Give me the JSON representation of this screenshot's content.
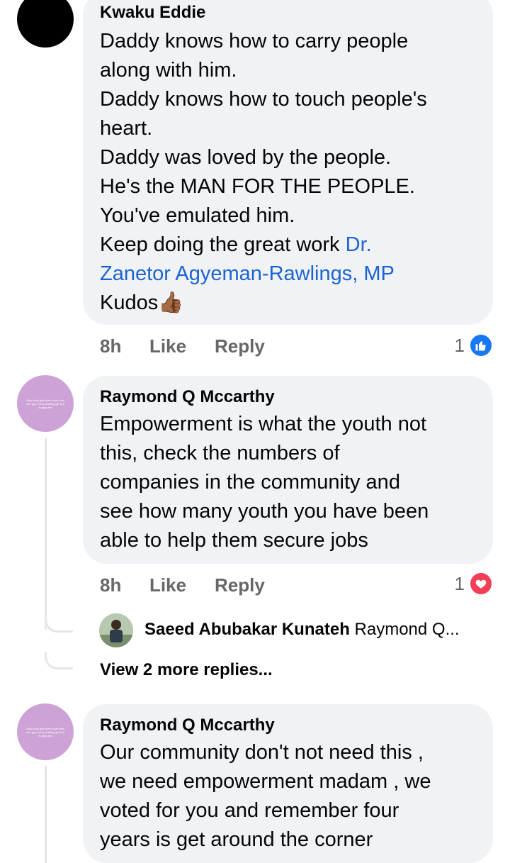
{
  "comments": [
    {
      "author": "Kwaku Eddie",
      "lines": [
        "Daddy knows how to carry people",
        "along with him.",
        "Daddy knows how to touch people's",
        "heart.",
        "Daddy was loved by the people.",
        "He's the MAN FOR THE PEOPLE.",
        "You've emulated him.",
        "Keep doing the great work "
      ],
      "mention_part1": "Dr.",
      "mention_part2": "Zanetor Agyeman-Rawlings, MP",
      "last_line": "Kudos",
      "emoji": "👍🏾",
      "time": "8h",
      "like": "Like",
      "reply": "Reply",
      "reaction_count": "1",
      "reaction_type": "like-icon",
      "reaction_color": "#1877f2"
    },
    {
      "author": "Raymond Q Mccarthy",
      "avatar_text": "Only fools give their more than one guy every chatting girl is a hungry lion",
      "lines": [
        "Empowerment is what the youth not",
        "this, check the numbers of",
        "companies in the community and",
        "see how many youth you have been",
        "able to help them secure jobs"
      ],
      "time": "8h",
      "like": "Like",
      "reply": "Reply",
      "reaction_count": "1",
      "reaction_type": "heart-icon",
      "reaction_color": "#f33e58",
      "reply_preview": {
        "author": "Saeed Abubakar Kunateh",
        "snippet": "Raymond Q..."
      },
      "view_more": "View 2 more replies..."
    },
    {
      "author": "Raymond Q Mccarthy",
      "avatar_text": "Only fools give their more than one guy every chatting girl is a hungry lion",
      "lines": [
        "Our community don't not need this ,",
        "we need empowerment madam , we",
        "voted for you and remember four",
        "years is get around the corner"
      ]
    }
  ]
}
